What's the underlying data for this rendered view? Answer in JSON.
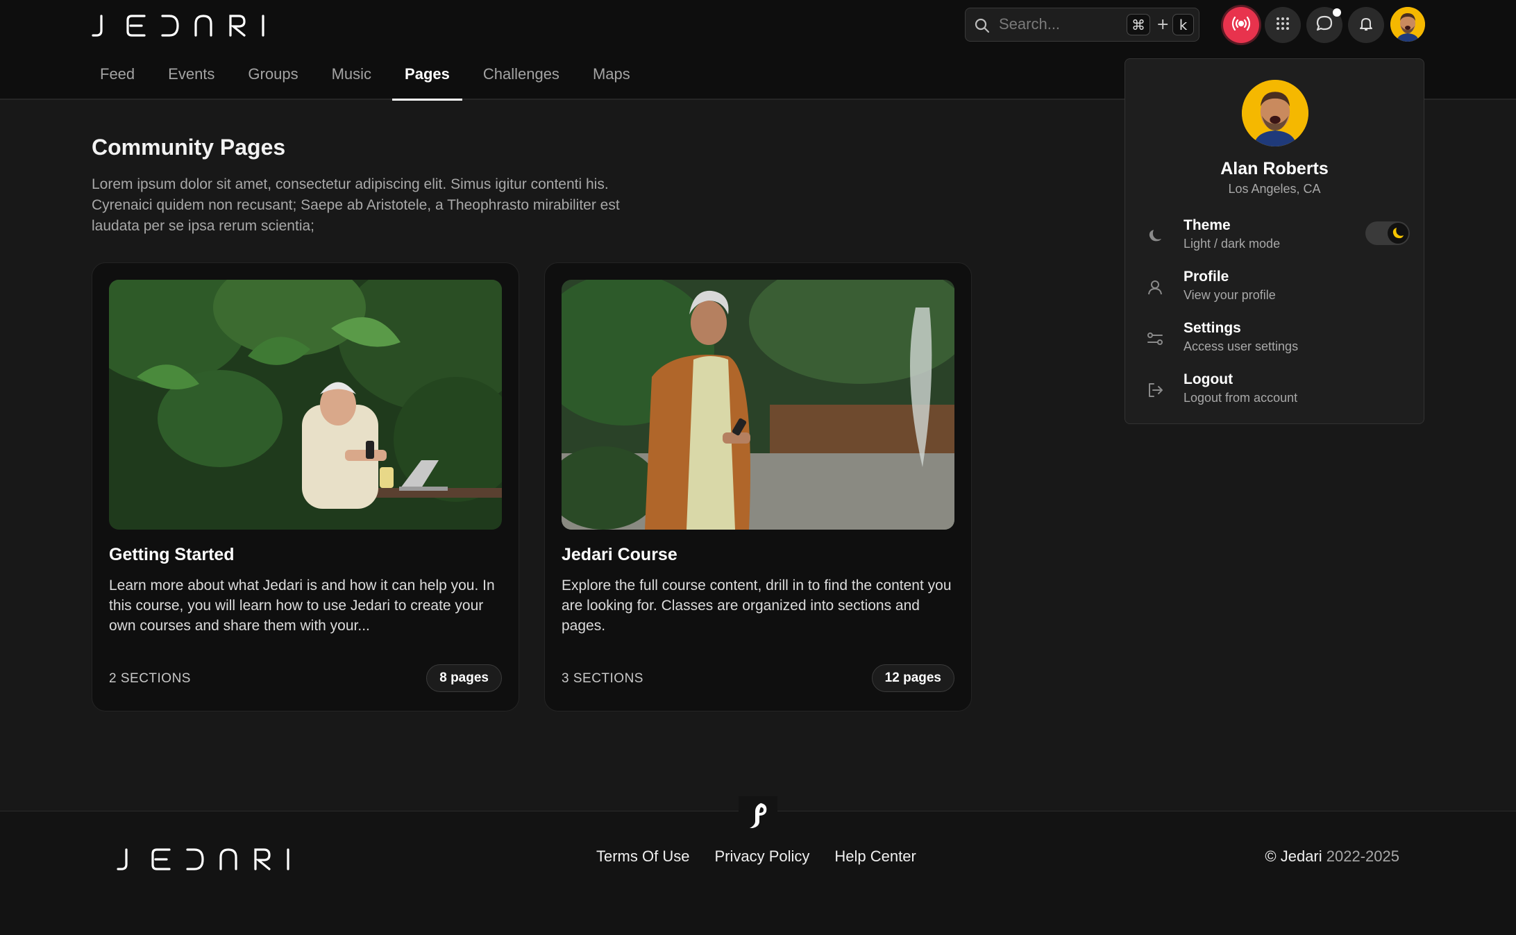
{
  "header": {
    "logo_text": "JEDARI",
    "search": {
      "placeholder": "Search...",
      "shortcut_mod": "⌘",
      "shortcut_plus": "+",
      "shortcut_key": "k"
    },
    "icons": [
      "live-broadcast-icon",
      "apps-grid-icon",
      "chat-bubble-icon",
      "bell-icon",
      "user-avatar"
    ]
  },
  "nav": {
    "tabs": [
      {
        "label": "Feed"
      },
      {
        "label": "Events"
      },
      {
        "label": "Groups"
      },
      {
        "label": "Music"
      },
      {
        "label": "Pages",
        "active": true
      },
      {
        "label": "Challenges"
      },
      {
        "label": "Maps"
      }
    ]
  },
  "main": {
    "title": "Community Pages",
    "description": "Lorem ipsum dolor sit amet, consectetur adipiscing elit. Simus igitur contenti his. Cyrenaici quidem non recusant; Saepe ab Aristotele, a Theophrasto mirabiliter est laudata per se ipsa rerum scientia;",
    "cards": [
      {
        "title": "Getting Started",
        "description": "Learn more about what Jedari is and how it can help you. In this course, you will learn how to use Jedari to create your own courses and share them with your...",
        "sections": "2  SECTIONS",
        "pages": "8 pages"
      },
      {
        "title": "Jedari Course",
        "description": "Explore the full course content, drill in to find the content you are looking for. Classes are organized into sections and pages.",
        "sections": "3  SECTIONS",
        "pages": "12 pages"
      }
    ]
  },
  "user_menu": {
    "name": "Alan Roberts",
    "location": "Los Angeles, CA",
    "items": [
      {
        "title": "Theme",
        "subtitle": "Light / dark mode",
        "icon": "moon-icon",
        "toggle_on": true
      },
      {
        "title": "Profile",
        "subtitle": "View your profile",
        "icon": "user-icon"
      },
      {
        "title": "Settings",
        "subtitle": "Access user settings",
        "icon": "sliders-icon"
      },
      {
        "title": "Logout",
        "subtitle": "Logout from account",
        "icon": "logout-icon"
      }
    ]
  },
  "footer": {
    "links": [
      "Terms Of Use",
      "Privacy Policy",
      "Help Center"
    ],
    "copyright_brand": "© Jedari",
    "copyright_years": "2022-2025"
  },
  "colors": {
    "background": "#181818",
    "header": "#0e0e0e",
    "live_accent": "#e8334d",
    "avatar_bg": "#f5b800",
    "toggle_moon": "#f5c400"
  }
}
